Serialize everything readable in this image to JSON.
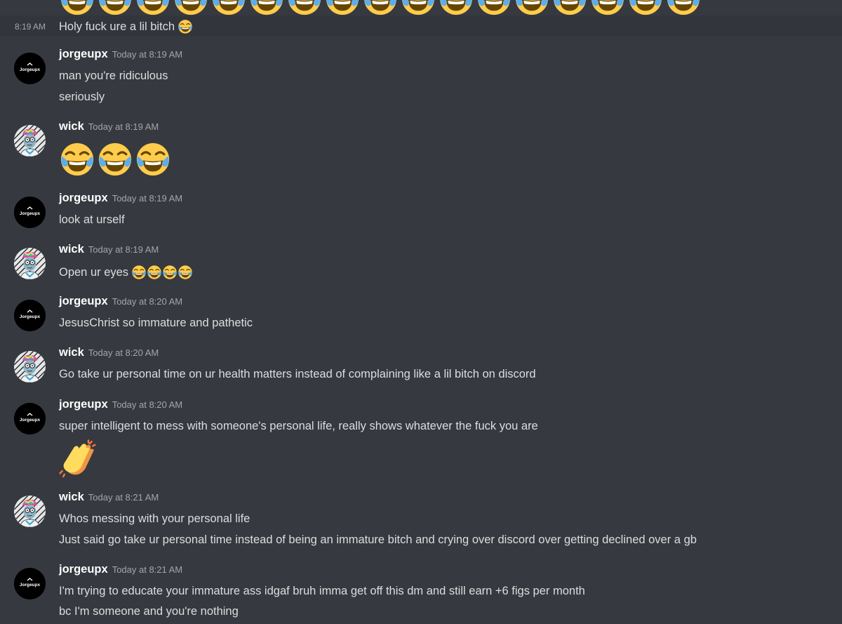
{
  "previous_message": {
    "time": "8:19 AM",
    "text": "Holy fuck ure a lil bitch"
  },
  "messages": [
    {
      "username": "jorgeupx",
      "timestamp": "Today at 8:19 AM",
      "avatar_label": "Jorgeupx",
      "lines": [
        "man you're ridiculous",
        "seriously"
      ]
    },
    {
      "username": "wick",
      "timestamp": "Today at 8:19 AM",
      "emoji": [
        "face-with-tears-of-joy-icon",
        "face-with-tears-of-joy-icon",
        "face-with-tears-of-joy-icon"
      ]
    },
    {
      "username": "jorgeupx",
      "timestamp": "Today at 8:19 AM",
      "avatar_label": "Jorgeupx",
      "lines": [
        "look at urself"
      ]
    },
    {
      "username": "wick",
      "timestamp": "Today at 8:19 AM",
      "lines": [
        "Open ur eyes"
      ]
    },
    {
      "username": "jorgeupx",
      "timestamp": "Today at 8:20 AM",
      "avatar_label": "Jorgeupx",
      "lines": [
        "JesusChrist so immature and pathetic"
      ]
    },
    {
      "username": "wick",
      "timestamp": "Today at 8:20 AM",
      "lines": [
        "Go take ur personal time on ur health matters instead of complaining like a lil bitch on discord"
      ]
    },
    {
      "username": "jorgeupx",
      "timestamp": "Today at 8:20 AM",
      "avatar_label": "Jorgeupx",
      "lines": [
        "super intelligent to mess with someone's personal life, really shows whatever the fuck you are"
      ],
      "emoji": [
        "clapping-hands-icon"
      ]
    },
    {
      "username": "wick",
      "timestamp": "Today at 8:21 AM",
      "lines": [
        "Whos messing with your personal life",
        "Just said go take ur personal time instead of being an immature bitch and crying over discord over getting declined over a gb"
      ]
    },
    {
      "username": "jorgeupx",
      "timestamp": "Today at 8:21 AM",
      "avatar_label": "Jorgeupx",
      "lines": [
        "I'm trying to educate your immature ass idgaf bruh imma get off this dm and still earn +6 figs per month",
        "bc I'm someone and you're nothing"
      ]
    }
  ],
  "colors": {
    "background": "#36393f",
    "hover_background": "#32353b",
    "username": "#ffffff",
    "text": "#dcddde",
    "timestamp": "#a3a6aa"
  }
}
